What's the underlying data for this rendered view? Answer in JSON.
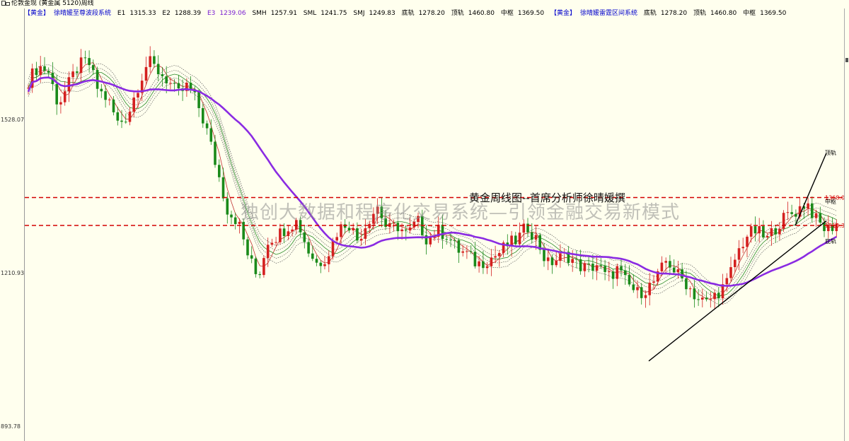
{
  "window": {
    "title": "伦敦金现 (黄金属 5120)周线"
  },
  "indicators": {
    "left_tag": "【黄金】",
    "left_name": "徐晴媛至尊波段系统",
    "e1_label": "E1",
    "e1_value": "1315.33",
    "e2_label": "E2",
    "e2_value": "1288.39",
    "e3_label": "E3",
    "e3_value": "1239.06",
    "smh_label": "SMH",
    "smh_value": "1257.91",
    "sml_label": "SML",
    "sml_value": "1241.75",
    "smj_label": "SMJ",
    "smj_value": "1249.83",
    "bottom_label": "底轨",
    "bottom_value": "1278.20",
    "top_label": "顶轨",
    "top_value": "1460.80",
    "mid_label": "中枢",
    "mid_value": "1369.50",
    "right_tag": "【黄金】",
    "right_name": "徐晴媛雷霆区间系统",
    "r_bottom_label": "底轨",
    "r_bottom_value": "1278.20",
    "r_top_label": "顶轨",
    "r_top_value": "1460.80",
    "r_mid_label": "中枢",
    "r_mid_value": "1369.50"
  },
  "annotations": {
    "headline": "黄金周线图--首席分析师徐晴媛撰",
    "watermark": "独创大数据和程序化交易系统—引领金融交易新模式"
  },
  "colors": {
    "up": "#d42020",
    "down": "#1a8a1a",
    "ma_long": "#8a2be2",
    "level": "#d40000",
    "channel": "#000000",
    "background": "#ffffee"
  },
  "chart_data": {
    "type": "candlestick",
    "title": "",
    "xlabel": "",
    "ylabel": "",
    "y_ticks": [
      "1528.07",
      "1210.93",
      "893.78"
    ],
    "ylim": [
      893.78,
      1660
    ],
    "levels": [
      {
        "label": "顶轨",
        "value": 1460.8
      },
      {
        "label": "1368.00",
        "value": 1368.0
      },
      {
        "label": "中枢",
        "value": 1360.0
      },
      {
        "label": "1310.30",
        "value": 1310.3
      },
      {
        "label": "底轨",
        "value": 1278.2
      }
    ],
    "close_path": [
      1610,
      1640,
      1630,
      1560,
      1600,
      1640,
      1650,
      1590,
      1570,
      1520,
      1540,
      1600,
      1650,
      1630,
      1610,
      1580,
      1600,
      1560,
      1500,
      1420,
      1340,
      1320,
      1250,
      1200,
      1280,
      1290,
      1310,
      1320,
      1260,
      1230,
      1250,
      1300,
      1320,
      1280,
      1320,
      1350,
      1300,
      1310,
      1290,
      1320,
      1280,
      1300,
      1290,
      1260,
      1250,
      1230,
      1240,
      1250,
      1270,
      1280,
      1310,
      1280,
      1230,
      1240,
      1250,
      1230,
      1220,
      1230,
      1200,
      1220,
      1190,
      1170,
      1180,
      1200,
      1240,
      1210,
      1190,
      1160,
      1150,
      1170,
      1190,
      1250,
      1290,
      1300,
      1280,
      1310,
      1330,
      1340,
      1360,
      1320,
      1300,
      1315
    ],
    "channel_upper": [
      [
        1124,
        1310
      ],
      [
        1168,
        1460
      ]
    ],
    "channel_lower": [
      [
        917,
        1030
      ],
      [
        1168,
        1320
      ]
    ]
  }
}
